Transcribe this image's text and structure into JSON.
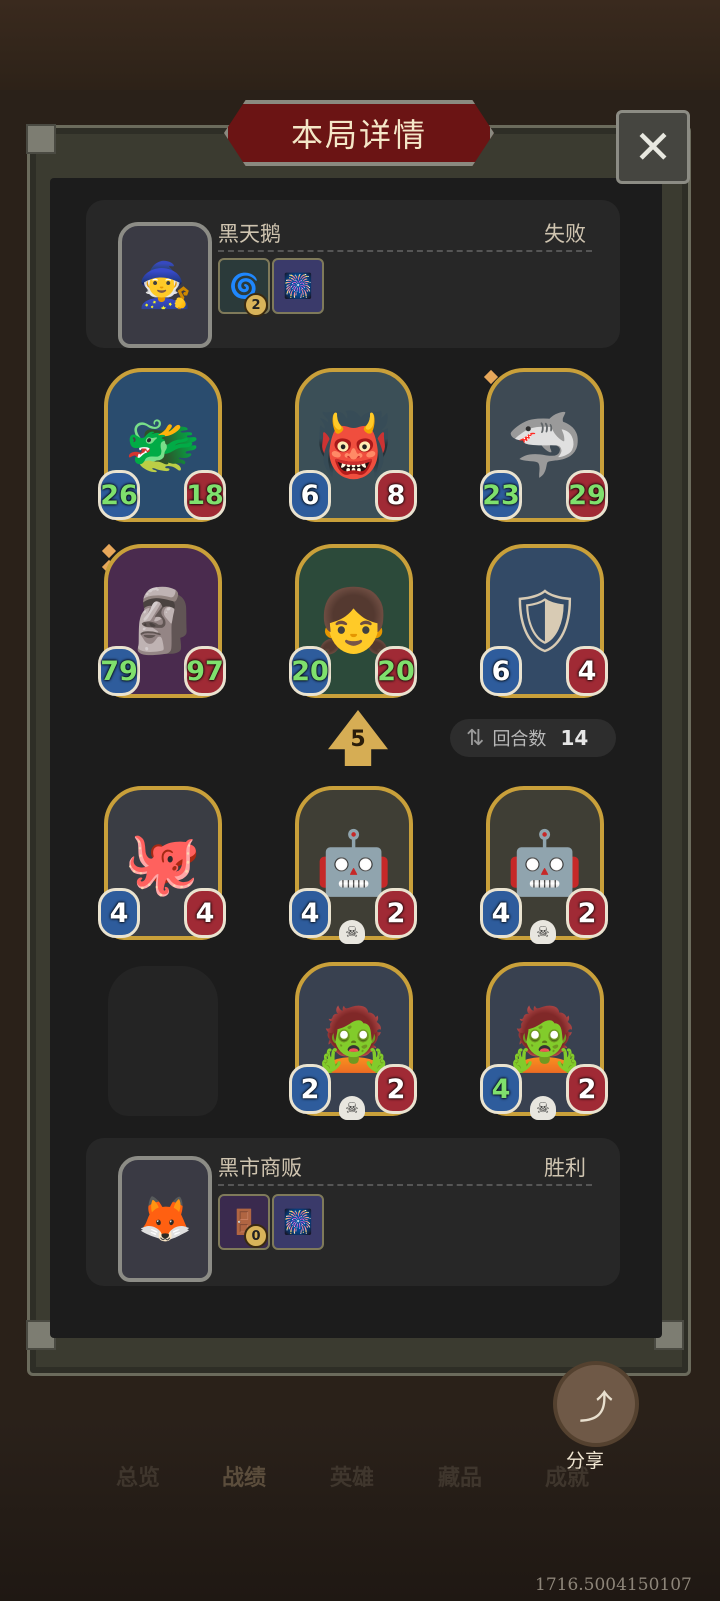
{
  "title": "本局详情",
  "close_icon": "close-icon",
  "player_top": {
    "name": "黑天鹅",
    "result": "失败",
    "portrait_icon": "hooded-hero-icon",
    "items": [
      {
        "icon": "green-spell-icon",
        "badge": "2"
      },
      {
        "icon": "fireworks-icon",
        "badge": ""
      }
    ]
  },
  "board_top": [
    {
      "icon": "blue-dragon-icon",
      "atk": "26",
      "hp": "18",
      "buffed_atk": true,
      "buffed_hp": true
    },
    {
      "icon": "horned-beast-icon",
      "atk": "6",
      "hp": "8",
      "buffed_atk": false,
      "buffed_hp": false
    },
    {
      "icon": "shark-icon",
      "atk": "23",
      "hp": "29",
      "buffed_atk": true,
      "buffed_hp": true
    },
    {
      "icon": "wooden-totem-icon",
      "atk": "79",
      "hp": "97",
      "buffed_atk": true,
      "buffed_hp": true
    },
    {
      "icon": "orange-girl-icon",
      "atk": "20",
      "hp": "20",
      "buffed_atk": true,
      "buffed_hp": true
    },
    {
      "icon": "armored-knight-icon",
      "atk": "6",
      "hp": "4",
      "buffed_atk": false,
      "buffed_hp": false
    }
  ],
  "tier": "5",
  "turns": {
    "label": "回合数",
    "value": "14"
  },
  "board_bottom": [
    {
      "icon": "jellyfish-bot-icon",
      "atk": "4",
      "hp": "4",
      "skull": false
    },
    {
      "icon": "robot-icon",
      "atk": "4",
      "hp": "2",
      "skull": true
    },
    {
      "icon": "robot-icon",
      "atk": "4",
      "hp": "2",
      "skull": true
    },
    {
      "icon": "hooded-ghoul-icon",
      "atk": "2",
      "hp": "2",
      "skull": true
    },
    {
      "icon": "hooded-ghoul-icon",
      "atk": "4",
      "hp": "2",
      "skull": true
    }
  ],
  "player_bottom": {
    "name": "黑市商贩",
    "result": "胜利",
    "portrait_icon": "jackal-merchant-icon",
    "items": [
      {
        "icon": "purple-door-icon",
        "badge": "0"
      },
      {
        "icon": "fireworks-icon",
        "badge": ""
      }
    ]
  },
  "share": {
    "label": "分享",
    "icon": "share-icon"
  },
  "nav": [
    "总览",
    "战绩",
    "英雄",
    "藏品",
    "成就"
  ],
  "coord": "1716.5004150107",
  "colors": {
    "accent_gold": "#c9a03a",
    "title_red": "#6b1414",
    "atk_blue": "#2e5c9c",
    "hp_red": "#a02a35",
    "buff_green": "#7fe06d"
  }
}
